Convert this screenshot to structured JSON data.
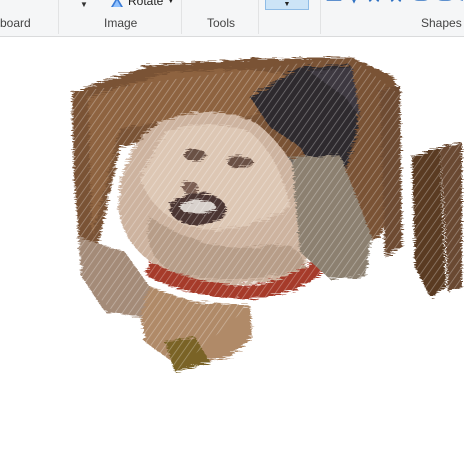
{
  "ribbon": {
    "groups": {
      "clipboard": "board",
      "image": "Image",
      "tools": "Tools",
      "shapes": "Shapes"
    },
    "rotate_label": "Rotate",
    "shape_icons": [
      "diamond-icon",
      "teardrop-icon",
      "star-icon",
      "star-icon",
      "speech-bubble-icon",
      "speech-bubble-icon"
    ]
  },
  "colors": {
    "ribbon_bg": "#f5f6f7",
    "selected_blue": "#cce4f7",
    "canvas_bg": "#ffffff"
  }
}
